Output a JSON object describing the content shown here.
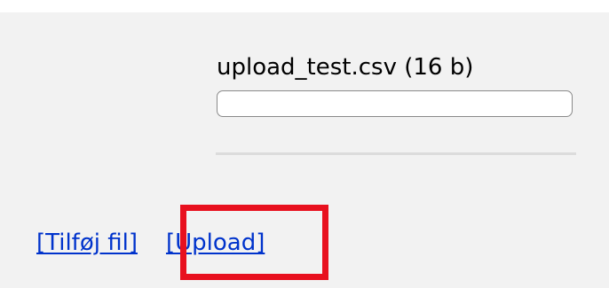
{
  "file": {
    "name": "upload_test.csv (16 b)",
    "input_value": ""
  },
  "actions": {
    "add_file_label": "[Tilføj fil]",
    "upload_label": "[Upload]"
  },
  "colors": {
    "background": "#f2f2f2",
    "link": "#0033cc",
    "highlight": "#e8101e"
  }
}
